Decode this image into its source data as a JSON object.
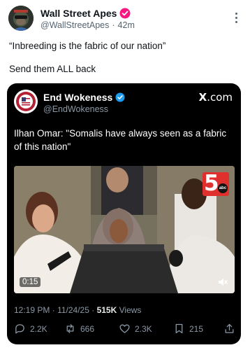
{
  "post": {
    "display_name": "Wall Street Apes",
    "handle": "@WallStreetApes",
    "separator": "·",
    "time_ago": "42m",
    "text_line_1": "“Inbreeding is the fabric of our nation”",
    "text_line_2": "Send them ALL back",
    "avatar_icon": "ape-avatar-icon",
    "verified_badge_color": "#f91880",
    "more_icon": "vertical-ellipsis-icon"
  },
  "quote": {
    "display_name": "End Wokeness",
    "handle": "@EndWokeness",
    "verified_badge_color": "#1d9bf0",
    "brand_x": "X",
    "brand_suffix": ".com",
    "text": "Ilhan Omar: \"Somalis have always seen as a fabric of this nation\"",
    "avatar_icon": "end-wokeness-emblem-icon"
  },
  "video": {
    "duration": "0:15",
    "station_logo_number": "5",
    "station_logo_network": "abc",
    "station_logo_color": "#e0302d",
    "volume_icon": "speaker-muted-icon"
  },
  "stamp": {
    "time": "12:19 PM",
    "separator": "·",
    "date": "11/24/25",
    "views_count": "515K",
    "views_label": "Views"
  },
  "actions": {
    "replies": "2.2K",
    "reposts": "666",
    "likes": "2.3K",
    "bookmarks": "215"
  },
  "colors": {
    "background": "#ffffff",
    "text_primary": "#0f1419",
    "text_secondary": "#536471",
    "card_background": "#000000",
    "card_text_secondary": "#8b98a5"
  }
}
